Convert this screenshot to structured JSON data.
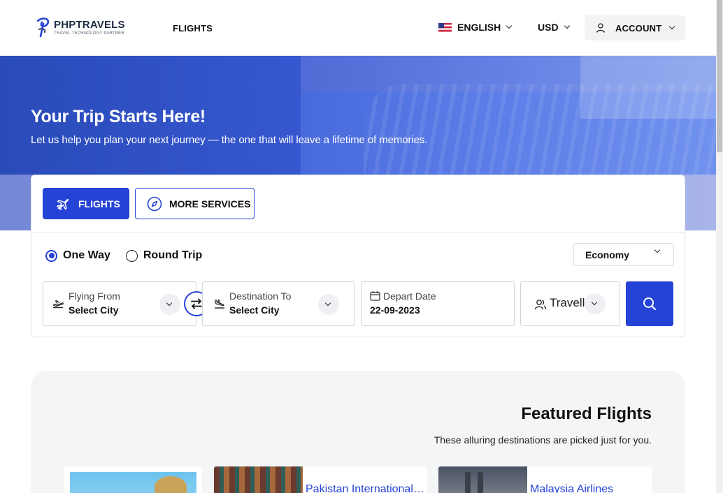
{
  "header": {
    "logo_name": "PHPTRAVELS",
    "logo_tagline": "TRAVEL TECHNOLOGY PARTNER",
    "nav": [
      {
        "label": "FLIGHTS"
      }
    ],
    "language": "ENGLISH",
    "currency": "USD",
    "account": "ACCOUNT"
  },
  "hero": {
    "title": "Your Trip Starts Here!",
    "subtitle": "Let us help you plan your next journey — the one that will leave a lifetime of memories."
  },
  "search": {
    "tabs": [
      {
        "label": "FLIGHTS",
        "active": true
      },
      {
        "label": "MORE SERVICES",
        "active": false
      }
    ],
    "trip_types": [
      {
        "label": "One Way",
        "selected": true
      },
      {
        "label": "Round Trip",
        "selected": false
      }
    ],
    "cabin_class": "Economy",
    "from": {
      "label": "Flying From",
      "value": "Select City"
    },
    "to": {
      "label": "Destination To",
      "value": "Select City"
    },
    "date": {
      "label": "Depart Date",
      "value": "22-09-2023"
    },
    "travellers": {
      "placeholder": "Travellers"
    }
  },
  "featured": {
    "title": "Featured Flights",
    "subtitle": "These alluring destinations are picked just for you.",
    "cards": [
      {
        "airline": ""
      },
      {
        "airline": "Pakistan International Airlines"
      },
      {
        "airline": "Malaysia Airlines"
      }
    ]
  },
  "colors": {
    "accent": "#2543d6"
  }
}
